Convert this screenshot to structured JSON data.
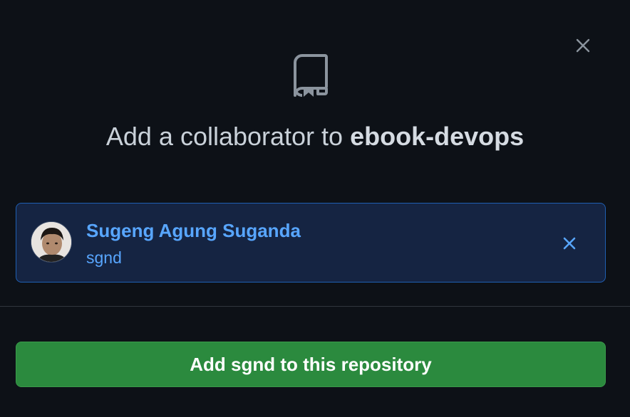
{
  "dialog": {
    "title_prefix": "Add a collaborator to ",
    "repo_name": "ebook-devops",
    "close_icon": "close-icon",
    "repo_icon": "repo-icon"
  },
  "selected_user": {
    "full_name": "Sugeng Agung Suganda",
    "login": "sgnd",
    "remove_icon": "close-icon"
  },
  "actions": {
    "add_button_label": "Add sgnd to this repository"
  },
  "colors": {
    "background": "#0d1117",
    "link_blue": "#58a6ff",
    "selected_bg": "#152442",
    "selected_border": "#1f5fb3",
    "primary_green": "#2b8a3e",
    "muted_icon": "#8b949e"
  }
}
